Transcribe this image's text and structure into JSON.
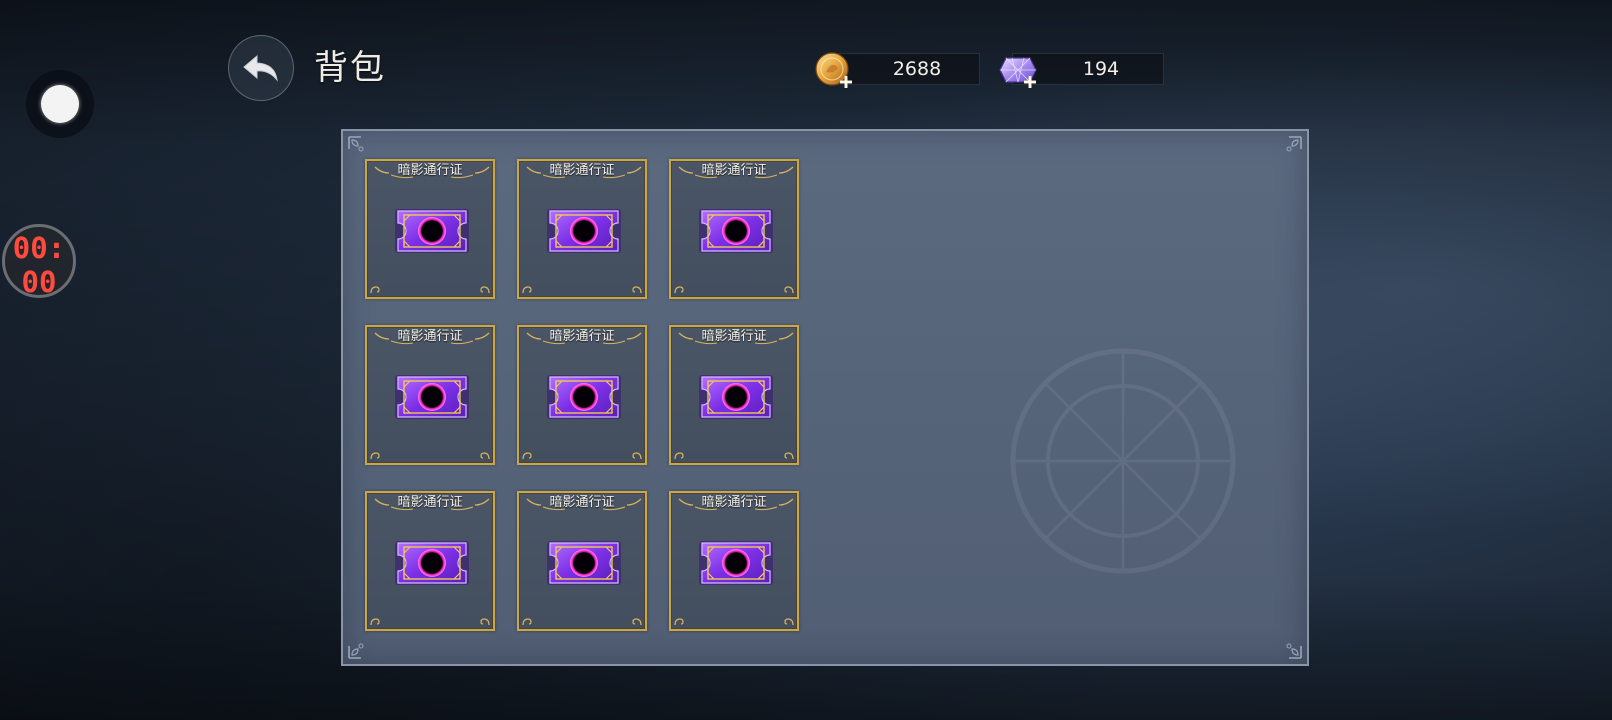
{
  "header": {
    "title": "背包",
    "back_icon": "back-arrow-icon"
  },
  "currencies": [
    {
      "id": "gold",
      "icon": "gold-coin-icon",
      "value": "2688"
    },
    {
      "id": "gem",
      "icon": "crystal-gem-icon",
      "value": "194"
    }
  ],
  "overlay": {
    "timer_line1": "00:",
    "timer_line2": "00",
    "timer_color": "#ff4b3e"
  },
  "inventory": {
    "items": [
      {
        "name": "暗影通行证",
        "icon": "shadow-pass-ticket-icon"
      },
      {
        "name": "暗影通行证",
        "icon": "shadow-pass-ticket-icon"
      },
      {
        "name": "暗影通行证",
        "icon": "shadow-pass-ticket-icon"
      },
      {
        "name": "暗影通行证",
        "icon": "shadow-pass-ticket-icon"
      },
      {
        "name": "暗影通行证",
        "icon": "shadow-pass-ticket-icon"
      },
      {
        "name": "暗影通行证",
        "icon": "shadow-pass-ticket-icon"
      },
      {
        "name": "暗影通行证",
        "icon": "shadow-pass-ticket-icon"
      },
      {
        "name": "暗影通行证",
        "icon": "shadow-pass-ticket-icon"
      },
      {
        "name": "暗影通行证",
        "icon": "shadow-pass-ticket-icon"
      }
    ]
  },
  "colors": {
    "slot_border": "#c9a64a",
    "ticket_purple": "#8a3cf0",
    "ticket_glow": "#ff3cc8"
  }
}
